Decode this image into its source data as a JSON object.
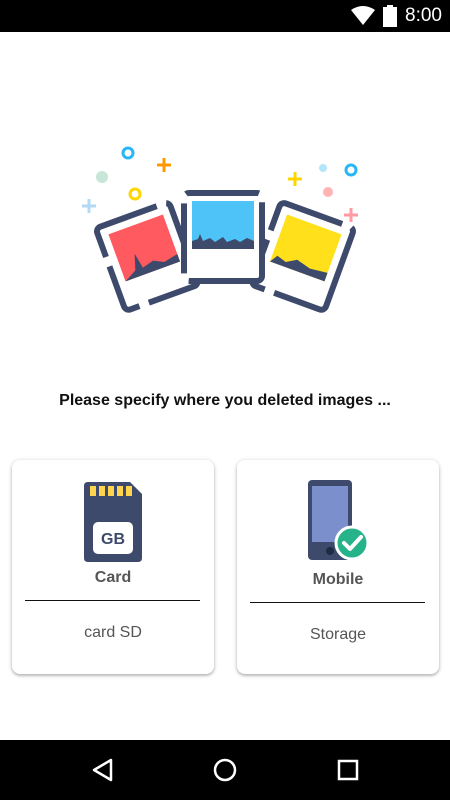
{
  "status_bar": {
    "time": "8:00",
    "icons": [
      "wifi-icon",
      "battery-icon"
    ]
  },
  "prompt": "Please specify where you deleted images ...",
  "options": [
    {
      "title": "Card",
      "subtitle": "card SD",
      "icon": "sd-card-icon",
      "icon_label": "GB"
    },
    {
      "title": "Mobile",
      "subtitle": "Storage",
      "icon": "phone-check-icon"
    }
  ],
  "nav_bar": {
    "icons": [
      "back-icon",
      "home-icon",
      "recents-icon"
    ]
  },
  "colors": {
    "navy": "#3d4a6b",
    "red_photo": "#ff5a5f",
    "blue_photo": "#4ec3f7",
    "yellow_photo": "#ffe01b",
    "check_green": "#26b38a",
    "phone_screen": "#7b8fcc"
  }
}
